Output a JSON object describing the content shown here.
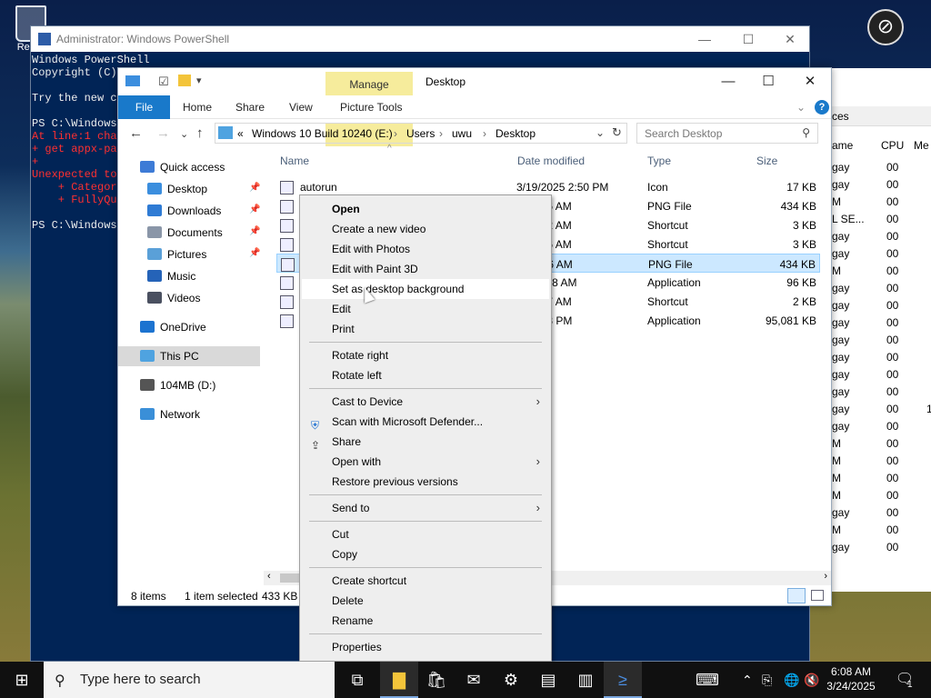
{
  "desktop": {
    "recycle_label": "Recyc"
  },
  "powershell": {
    "title": "Administrator: Windows PowerShell",
    "lines": [
      {
        "text": "Windows PowerShell",
        "err": false
      },
      {
        "text": "Copyright (C)",
        "err": false
      },
      {
        "text": "",
        "err": false
      },
      {
        "text": "Try the new cr",
        "err": false
      },
      {
        "text": "",
        "err": false
      },
      {
        "text": "PS C:\\Windows\\",
        "err": false
      },
      {
        "text": "At line:1 char",
        "err": true
      },
      {
        "text": "+ get appx-pa",
        "err": true
      },
      {
        "text": "+",
        "err": true
      },
      {
        "text": "Unexpected tok",
        "err": true
      },
      {
        "text": "    + Category",
        "err": true
      },
      {
        "text": "    + FullyQu",
        "err": true
      },
      {
        "text": "",
        "err": false
      },
      {
        "text": "PS C:\\Windows\\",
        "err": false
      }
    ]
  },
  "taskmgr": {
    "tab": "ces",
    "headers": [
      "ame",
      "CPU",
      "Me"
    ],
    "rows": [
      [
        "gay",
        "00",
        ""
      ],
      [
        "gay",
        "00",
        ""
      ],
      [
        "M",
        "00",
        ""
      ],
      [
        "L SE...",
        "00",
        ""
      ],
      [
        "gay",
        "00",
        ""
      ],
      [
        "gay",
        "00",
        ""
      ],
      [
        "M",
        "00",
        ""
      ],
      [
        "gay",
        "00",
        ""
      ],
      [
        "gay",
        "00",
        ""
      ],
      [
        "gay",
        "00",
        ""
      ],
      [
        "gay",
        "00",
        ""
      ],
      [
        "gay",
        "00",
        ""
      ],
      [
        "gay",
        "00",
        ""
      ],
      [
        "gay",
        "00",
        ""
      ],
      [
        "gay",
        "00",
        "1"
      ],
      [
        "gay",
        "00",
        ""
      ],
      [
        "M",
        "00",
        ""
      ],
      [
        "M",
        "00",
        ""
      ],
      [
        "M",
        "00",
        ""
      ],
      [
        "M",
        "00",
        ""
      ],
      [
        "gay",
        "00",
        ""
      ],
      [
        "M",
        "00",
        ""
      ],
      [
        "gay",
        "00",
        ""
      ]
    ]
  },
  "explorer": {
    "manage_tab": "Manage",
    "title": "Desktop",
    "ribbon": {
      "file": "File",
      "home": "Home",
      "share": "Share",
      "view": "View",
      "picture_tools": "Picture Tools"
    },
    "address": {
      "prefix": "«",
      "parts": [
        "Windows 10 Build 10240 (E:)",
        "Users",
        "uwu",
        "Desktop"
      ],
      "sep": "›"
    },
    "search_placeholder": "Search Desktop",
    "sidebar": [
      {
        "label": "Quick access",
        "pinned": false,
        "indent": false,
        "icon": "star-icon",
        "color": "#3d7bd6"
      },
      {
        "label": "Desktop",
        "pinned": true,
        "indent": true,
        "icon": "desktop-folder-icon",
        "color": "#3b8ede"
      },
      {
        "label": "Downloads",
        "pinned": true,
        "indent": true,
        "icon": "download-icon",
        "color": "#2f7bd4"
      },
      {
        "label": "Documents",
        "pinned": true,
        "indent": true,
        "icon": "documents-icon",
        "color": "#8a96a8"
      },
      {
        "label": "Pictures",
        "pinned": true,
        "indent": true,
        "icon": "pictures-icon",
        "color": "#5aa0d8"
      },
      {
        "label": "Music",
        "pinned": false,
        "indent": true,
        "icon": "music-icon",
        "color": "#2563b8"
      },
      {
        "label": "Videos",
        "pinned": false,
        "indent": true,
        "icon": "videos-icon",
        "color": "#4a5060"
      },
      {
        "label": "OneDrive",
        "pinned": false,
        "indent": false,
        "icon": "onedrive-icon",
        "color": "#1c73d0"
      },
      {
        "label": "This PC",
        "pinned": false,
        "indent": false,
        "icon": "this-pc-icon",
        "color": "#4fa3e0",
        "selected": true
      },
      {
        "label": "104MB (D:)",
        "pinned": false,
        "indent": false,
        "icon": "drive-icon",
        "color": "#555555"
      },
      {
        "label": "Network",
        "pinned": false,
        "indent": false,
        "icon": "network-icon",
        "color": "#3a8fd8"
      }
    ],
    "columns": [
      "Name",
      "Date modified",
      "Type",
      "Size"
    ],
    "files": [
      {
        "name": "autorun",
        "date": "3/19/2025 2:50 PM",
        "type": "Icon",
        "size": "17 KB",
        "selected": false
      },
      {
        "name": "",
        "date": "25 5:16 AM",
        "type": "PNG File",
        "size": "434 KB",
        "selected": false
      },
      {
        "name": "",
        "date": "25 4:52 AM",
        "type": "Shortcut",
        "size": "3 KB",
        "selected": false
      },
      {
        "name": "",
        "date": "25 3:46 AM",
        "type": "Shortcut",
        "size": "3 KB",
        "selected": false
      },
      {
        "name": "",
        "date": "25 5:36 AM",
        "type": "PNG File",
        "size": "434 KB",
        "selected": true
      },
      {
        "name": "",
        "date": "25 11:28 AM",
        "type": "Application",
        "size": "96 KB",
        "selected": false
      },
      {
        "name": "",
        "date": "25 3:37 AM",
        "type": "Shortcut",
        "size": "2 KB",
        "selected": false
      },
      {
        "name": "",
        "date": "25 6:03 PM",
        "type": "Application",
        "size": "95,081 KB",
        "selected": false
      }
    ],
    "status": {
      "count": "8 items",
      "selection": "1 item selected",
      "size": "433 KB"
    }
  },
  "context_menu": {
    "groups": [
      [
        {
          "label": "Open",
          "bold": true
        },
        {
          "label": "Create a new video"
        },
        {
          "label": "Edit with Photos"
        },
        {
          "label": "Edit with Paint 3D"
        },
        {
          "label": "Set as desktop background",
          "hover": true
        },
        {
          "label": "Edit"
        },
        {
          "label": "Print"
        }
      ],
      [
        {
          "label": "Rotate right"
        },
        {
          "label": "Rotate left"
        }
      ],
      [
        {
          "label": "Cast to Device",
          "sub": true
        },
        {
          "label": "Scan with Microsoft Defender...",
          "icon": "defender-icon"
        },
        {
          "label": "Share",
          "icon": "share-icon"
        },
        {
          "label": "Open with",
          "sub": true
        },
        {
          "label": "Restore previous versions"
        }
      ],
      [
        {
          "label": "Send to",
          "sub": true
        }
      ],
      [
        {
          "label": "Cut"
        },
        {
          "label": "Copy"
        }
      ],
      [
        {
          "label": "Create shortcut"
        },
        {
          "label": "Delete"
        },
        {
          "label": "Rename"
        }
      ],
      [
        {
          "label": "Properties"
        }
      ]
    ]
  },
  "taskbar": {
    "search_placeholder": "Type here to search",
    "time": "6:08 AM",
    "date": "3/24/2025",
    "notification_count": "1"
  }
}
